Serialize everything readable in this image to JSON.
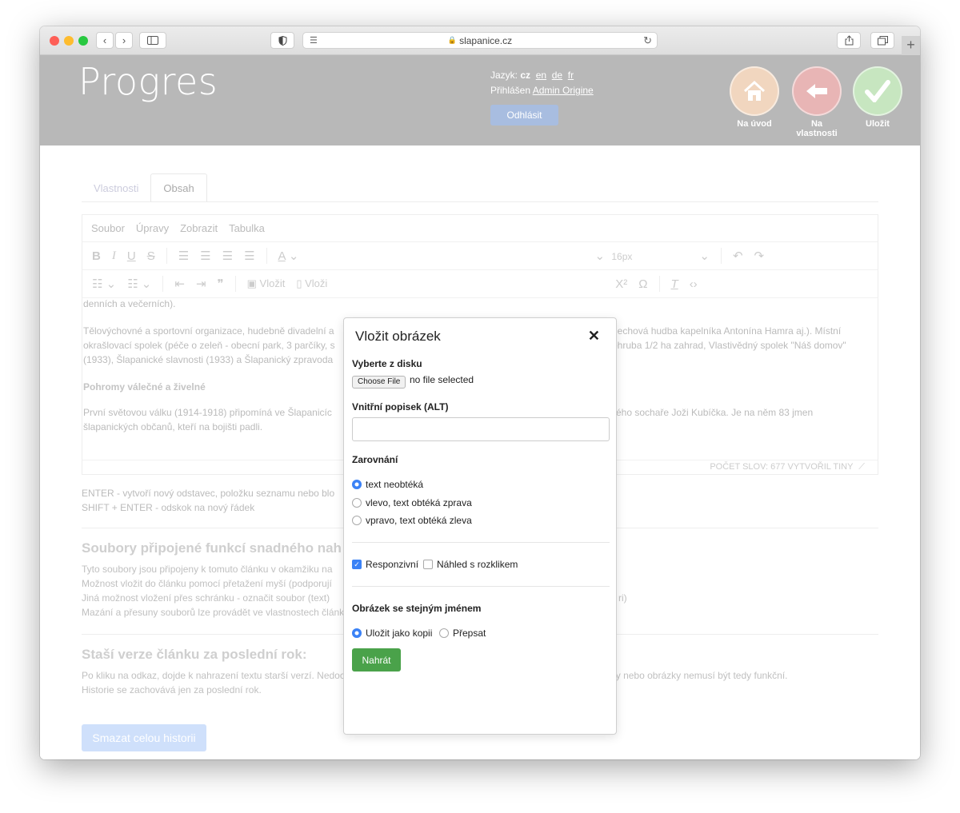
{
  "browser": {
    "url": "slapanice.cz",
    "lock_icon": "lock-icon",
    "colors": {
      "close": "#fe5f57",
      "minimize": "#febc2e",
      "zoom": "#28c840"
    }
  },
  "header": {
    "logo": "Progres",
    "language_label": "Jazyk:",
    "language_current": "cz",
    "languages": [
      "en",
      "de",
      "fr"
    ],
    "logged_in_label": "Přihlášen",
    "user_name": "Admin Origine",
    "logout": "Odhlásit",
    "buttons": [
      {
        "label": "Na úvod",
        "icon": "home-icon",
        "color": "#f1d6bf"
      },
      {
        "label": "Na vlastnosti",
        "icon": "arrow-left-icon",
        "color": "#e8b5b5"
      },
      {
        "label": "Uložit",
        "icon": "checkmark-icon",
        "color": "#c7e6c0"
      }
    ]
  },
  "tabs": {
    "properties": "Vlastnosti",
    "content": "Obsah"
  },
  "editor": {
    "menu": [
      "Soubor",
      "Úpravy",
      "Zobrazit",
      "Tabulka"
    ],
    "font_size": "16px",
    "insert_image": "Vložit",
    "insert_file": "Vloži",
    "text_top": "denních a večerních).",
    "para1": "Tělovýchovné a sportovní organizace, hudebně divadelní a",
    "para1_right": "dechová hudba kapelníka Antonína Hamra aj.). Místní",
    "para1_line2": "okrašlovací spolek (péče o zeleň - obecní park, 3 parčíky, s",
    "para1_line2_right": "ohruba 1/2 ha zahrad, Vlastivědný spolek \"Náš domov\"",
    "para1_line3": "(1933), Šlapanické slavnosti (1933) a Šlapanický zpravoda",
    "heading": "Pohromy válečné a živelné",
    "para2": "První světovou válku (1914-1918) připomíná ve Šlapanicíc",
    "para2_right": "ého sochaře Joži Kubíčka. Je na něm 83 jmen",
    "para2_line2": "šlapanických občanů, kteří na bojišti padli.",
    "status": "POČET SLOV: 677  VYTVOŘIL TINY"
  },
  "hints": {
    "enter": "ENTER - vytvoří nový odstavec, položku seznamu nebo blo",
    "shift_enter": "SHIFT + ENTER - odskok na nový řádek"
  },
  "attachments": {
    "title": "Soubory připojené funkcí snadného nah",
    "lines": [
      "Tyto soubory jsou připojeny k tomuto článku v okamžiku na",
      "Možnost vložit do článku pomocí přetažení myší (podporují",
      "Jiná možnost vložení přes schránku - označit soubor (text)",
      "Mazání a přesuny souborů lze provádět ve vlastnostech článku."
    ],
    "line3_tail": "ri)"
  },
  "history": {
    "title": "Staší verze článku za poslední rok:",
    "lines": [
      "Po kliku na odkaz, dojde k nahrazení textu starší verzí. Nedochází k obnově obrázků ani souborů, případné odkazy na soubory nebo obrázky nemusí být tedy funkční.",
      "Historie se zachovává jen za poslední rok."
    ],
    "clear_button": "Smazat celou historii"
  },
  "modal": {
    "title": "Vložit obrázek",
    "close_icon": "close-icon",
    "disk_label": "Vyberte z disku",
    "file_button": "Choose File",
    "file_status": "no file selected",
    "alt_label": "Vnitřní popisek (ALT)",
    "alt_value": "",
    "align_label": "Zarovnání",
    "align_options": [
      "text neobtéká",
      "vlevo, text obtéká zprava",
      "vpravo, text obtéká zleva"
    ],
    "align_selected": 0,
    "responsive_label": "Responzivní",
    "responsive_checked": true,
    "preview_label": "Náhled s rozklikem",
    "preview_checked": false,
    "same_name_label": "Obrázek se stejným jménem",
    "same_name_options": [
      "Uložit jako kopii",
      "Přepsat"
    ],
    "same_name_selected": 0,
    "upload_button": "Nahrát"
  }
}
